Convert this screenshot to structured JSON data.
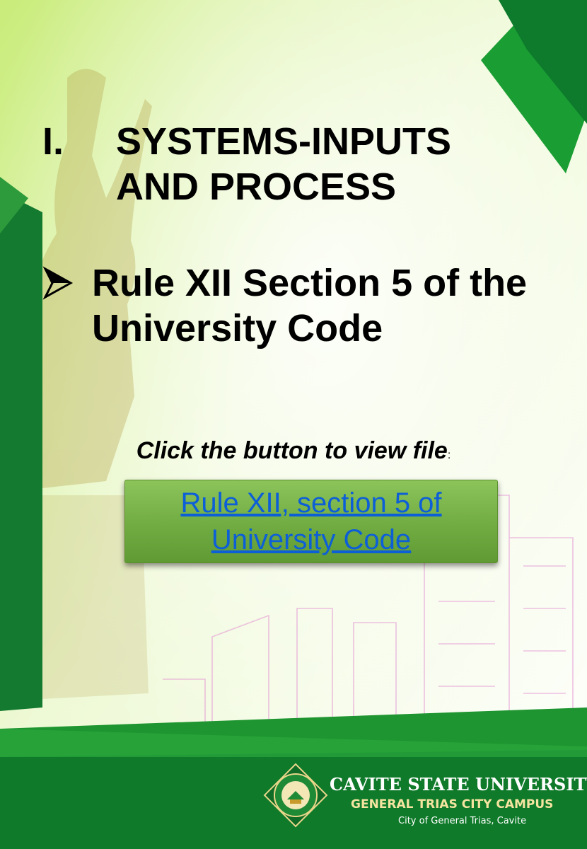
{
  "section": {
    "number": "I.",
    "title_line1": "SYSTEMS-INPUTS",
    "title_line2": "AND PROCESS"
  },
  "bullet": {
    "icon": "arrow-bullet-icon",
    "line1": "Rule XII Section 5 of the",
    "line2": "University Code"
  },
  "prompt": {
    "text": "Click the button to view file",
    "colon": ":"
  },
  "file_button": {
    "line1": "Rule XII, section 5 of",
    "line2": "University Code"
  },
  "footer": {
    "university": "CAVITE STATE UNIVERSITY",
    "campus": "GENERAL TRIAS CITY CAMPUS",
    "location": "City of General Trias, Cavite",
    "seal_icon": "university-seal-icon"
  },
  "colors": {
    "primary_green": "#1a8a2c",
    "dark_green": "#0f7a2a",
    "button_green": "#75b046",
    "link_blue": "#0d5fd8"
  }
}
